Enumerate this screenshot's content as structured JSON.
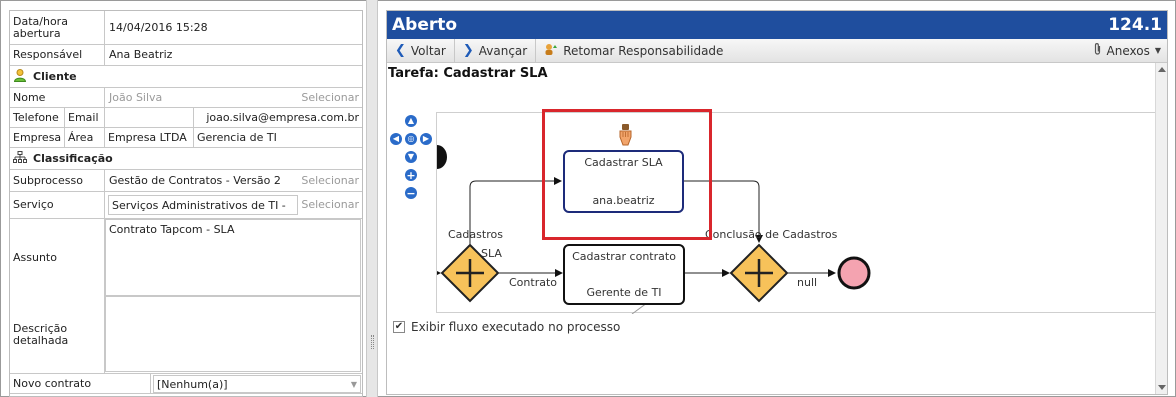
{
  "form": {
    "data_hora_label": "Data/hora abertura",
    "data_hora_value": "14/04/2016 15:28",
    "responsavel_label": "Responsável",
    "responsavel_value": "Ana Beatriz",
    "cliente_section": "Cliente",
    "nome_label": "Nome",
    "nome_value": "João Silva",
    "selecionar": "Selecionar",
    "telefone_label": "Telefone",
    "email_label": "Email",
    "email_value": "joao.silva@empresa.com.br",
    "empresa_label": "Empresa",
    "area_label": "Área",
    "empresa_value": "Empresa LTDA",
    "area_value": "Gerencia de TI",
    "classificacao_section": "Classificação",
    "subprocesso_label": "Subprocesso",
    "subprocesso_value": "Gestão de Contratos - Versão 2",
    "servico_label": "Serviço",
    "servico_value": "Serviços Administrativos de TI -",
    "assunto_label": "Assunto",
    "assunto_value": "Contrato Tapcom - SLA",
    "descricao_label": "Descrição detalhada",
    "descricao_value": "",
    "novo_contrato_label": "Novo contrato",
    "novo_contrato_value": "[Nenhum(a)]"
  },
  "panel": {
    "status": "Aberto",
    "number": "124.1",
    "voltar": "Voltar",
    "avancar": "Avançar",
    "retomar": "Retomar Responsabilidade",
    "anexos": "Anexos",
    "tarefa_prefix": "Tarefa:",
    "tarefa_name": "Cadastrar SLA",
    "checkbox_label": "Exibir fluxo executado no processo",
    "checkbox_checked": true
  },
  "diagram": {
    "task1_title": "Cadastrar SLA",
    "task1_user": "ana.beatriz",
    "task2_title": "Cadastrar contrato",
    "task2_group": "Gerente de TI",
    "label_cadastros": "Cadastros",
    "label_sla": "SLA",
    "label_contrato": "Contrato",
    "label_conclusao": "Conclusão de Cadastros",
    "label_null": "null"
  },
  "colors": {
    "title_bar": "#1f4e9e",
    "highlight": "#d9262c",
    "gateway": "#f7c25a",
    "end_event": "#f4a3b0"
  }
}
